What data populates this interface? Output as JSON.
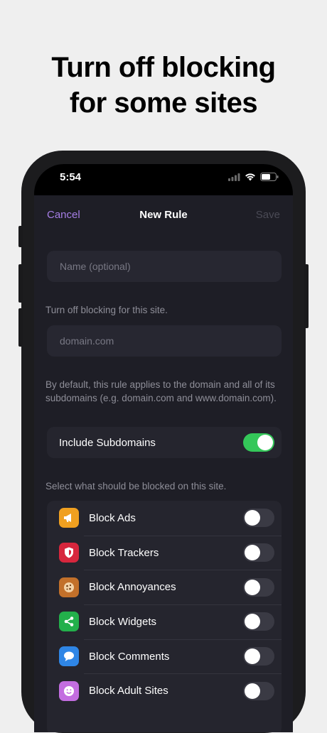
{
  "headline": {
    "line1": "Turn off blocking",
    "line2": "for some sites"
  },
  "status_bar": {
    "time": "5:54"
  },
  "nav": {
    "cancel": "Cancel",
    "title": "New Rule",
    "save": "Save"
  },
  "form": {
    "name_placeholder": "Name (optional)",
    "site_caption": "Turn off blocking for this site.",
    "domain_placeholder": "domain.com",
    "default_note": "By default, this rule applies to the domain and all of its subdomains (e.g. domain.com and www.domain.com).",
    "include_subdomains": {
      "label": "Include Subdomains",
      "on": true
    },
    "select_caption": "Select what should be blocked on this site."
  },
  "block_options": [
    {
      "label": "Block Ads",
      "icon": "megaphone-icon",
      "color": "#f0a020",
      "on": false
    },
    {
      "label": "Block Trackers",
      "icon": "shield-icon",
      "color": "#d7263d",
      "on": false
    },
    {
      "label": "Block Annoyances",
      "icon": "cookie-icon",
      "color": "#c2702a",
      "on": false
    },
    {
      "label": "Block Widgets",
      "icon": "share-icon",
      "color": "#23b04b",
      "on": false
    },
    {
      "label": "Block Comments",
      "icon": "chat-bubble-icon",
      "color": "#2f86e6",
      "on": false
    },
    {
      "label": "Block Adult Sites",
      "icon": "smiley-icon",
      "color": "#c36de0",
      "on": false
    }
  ],
  "colors": {
    "accent": "#a67ee6",
    "toggle_on": "#34c759",
    "background": "#1e1e26"
  }
}
